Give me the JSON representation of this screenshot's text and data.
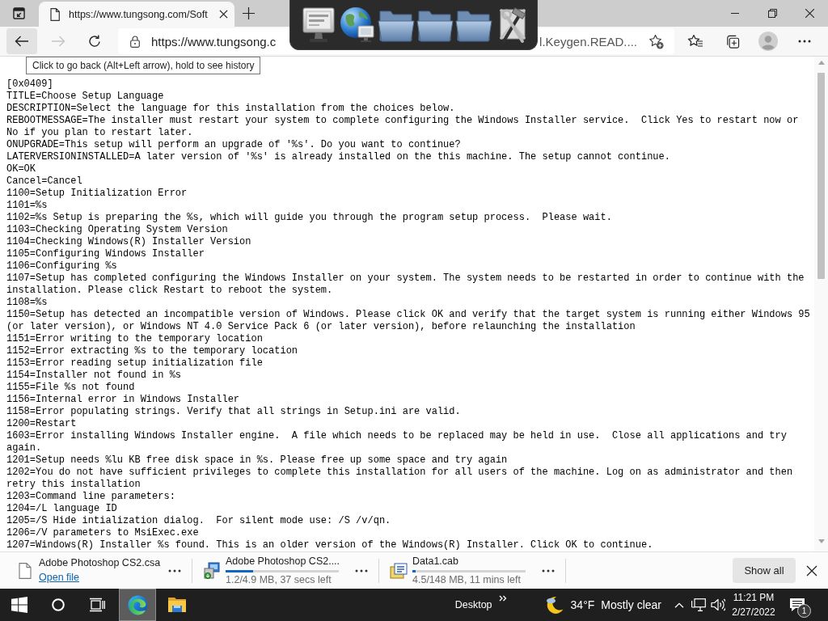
{
  "tab_strip": {
    "tabs": [
      {
        "title": "https://www.tungsong.com/Soft",
        "selected": true
      }
    ]
  },
  "toolbar": {
    "back": {
      "hovered": true,
      "tooltip": "Click to go back (Alt+Left arrow), hold to see history"
    },
    "forward": {
      "disabled": true
    },
    "address": {
      "text_start": "https://www.tungsong.c",
      "text_end": "l.Keygen.READ...."
    }
  },
  "document": {
    "lines": [
      "[0x0409]",
      "TITLE=Choose Setup Language",
      "DESCRIPTION=Select the language for this installation from the choices below.",
      "REBOOTMESSAGE=The installer must restart your system to complete configuring the Windows Installer service.  Click Yes to restart now or No if you plan to restart later.",
      "ONUPGRADE=This setup will perform an upgrade of '%s'. Do you want to continue?",
      "LATERVERSIONINSTALLED=A later version of '%s' is already installed on the this machine. The setup cannot continue.",
      "OK=OK",
      "Cancel=Cancel",
      "1100=Setup Initialization Error",
      "1101=%s",
      "1102=%s Setup is preparing the %s, which will guide you through the program setup process.  Please wait.",
      "1103=Checking Operating System Version",
      "1104=Checking Windows(R) Installer Version",
      "1105=Configuring Windows Installer",
      "1106=Configuring %s",
      "1107=Setup has completed configuring the Windows Installer on your system. The system needs to be restarted in order to continue with the installation. Please click Restart to reboot the system.",
      "1108=%s",
      "1150=Setup has detected an incompatible version of Windows. Please click OK and verify that the target system is running either Windows 95 (or later version), or Windows NT 4.0 Service Pack 6 (or later version), before relaunching the installation",
      "1151=Error writing to the temporary location",
      "1152=Error extracting %s to the temporary location",
      "1153=Error reading setup initialization file",
      "1154=Installer not found in %s",
      "1155=File %s not found",
      "1156=Internal error in Windows Installer",
      "1158=Error populating strings. Verify that all strings in Setup.ini are valid.",
      "1200=Restart",
      "1603=Error installing Windows Installer engine.  A file which needs to be replaced may be held in use.  Close all applications and try again.",
      "1201=Setup needs %lu KB free disk space in %s. Please free up some space and try again",
      "1202=You do not have sufficient privileges to complete this installation for all users of the machine. Log on as administrator and then retry this installation",
      "1203=Command line parameters:",
      "1204=/L language ID",
      "1205=/S Hide intialization dialog.  For silent mode use: /S /v/qn.",
      "1206=/V parameters to MsiExec.exe",
      "1207=Windows(R) Installer %s found. This is an older version of the Windows(R) Installer. Click OK to continue."
    ]
  },
  "downloads": {
    "items": [
      {
        "kind": "document",
        "name": "Adobe Photoshop CS2.csa",
        "action": "Open file"
      },
      {
        "kind": "installer",
        "name": "Adobe Photoshop CS2....",
        "level": 0.24,
        "status": "1.2/4.9 MB, 37 secs left"
      },
      {
        "kind": "archive",
        "name": "Data1.cab",
        "level": 0.03,
        "status": "4.5/148 MB, 11 mins left"
      }
    ],
    "show_all": "Show all"
  },
  "taskbar": {
    "apps": [
      {
        "kind": "browser",
        "selected": true
      },
      {
        "kind": "folder",
        "selected": false
      }
    ],
    "toolbar_label": "Desktop",
    "weather": {
      "temperature": "34°F",
      "condition": "Mostly clear"
    },
    "clock": {
      "time": "11:21 PM",
      "date": "2/27/2022"
    },
    "notification_count": "1"
  }
}
